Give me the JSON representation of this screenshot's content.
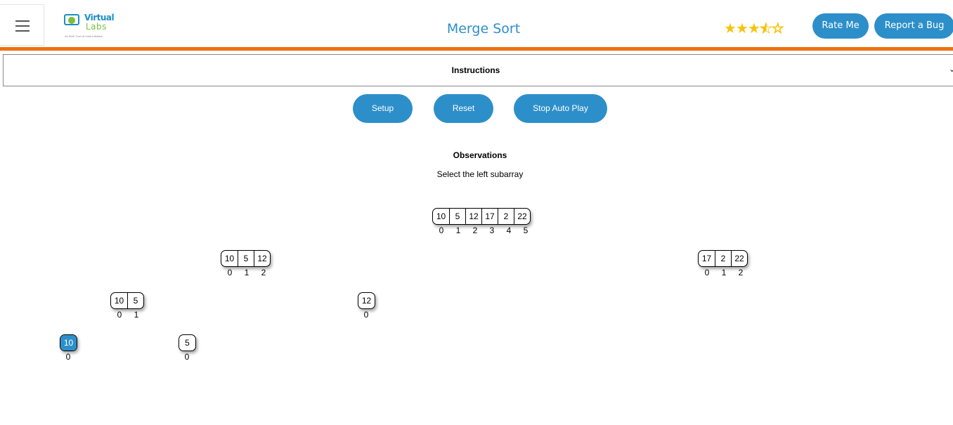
{
  "header": {
    "title": "Merge Sort",
    "logo": {
      "line1": "Virtual",
      "line2": "Labs",
      "tagline": "An MoE Govt of India Initiative"
    },
    "rating_stars": [
      "★",
      "★",
      "★",
      "★",
      "☆"
    ],
    "rating_value": 3.5,
    "rate_label": "Rate Me",
    "bug_label": "Report a Bug"
  },
  "instructions": {
    "label": "Instructions",
    "caret": "⌄"
  },
  "controls": {
    "setup": "Setup",
    "reset": "Reset",
    "stop": "Stop Auto Play"
  },
  "observations": {
    "title": "Observations",
    "text": "Select the left subarray"
  },
  "arrays": {
    "root": {
      "values": [
        "10",
        "5",
        "12",
        "17",
        "2",
        "22"
      ],
      "indices": [
        "0",
        "1",
        "2",
        "3",
        "4",
        "5"
      ]
    },
    "left": {
      "values": [
        "10",
        "5",
        "12"
      ],
      "indices": [
        "0",
        "1",
        "2"
      ]
    },
    "right": {
      "values": [
        "17",
        "2",
        "22"
      ],
      "indices": [
        "0",
        "1",
        "2"
      ]
    },
    "ll": {
      "values": [
        "10",
        "5"
      ],
      "indices": [
        "0",
        "1"
      ]
    },
    "lr": {
      "values": [
        "12"
      ],
      "indices": [
        "0"
      ]
    },
    "lll": {
      "values": [
        "10"
      ],
      "indices": [
        "0"
      ],
      "selected": true
    },
    "llr": {
      "values": [
        "5"
      ],
      "indices": [
        "0"
      ]
    }
  },
  "colors": {
    "accent": "#2d8fc9",
    "orange_bar": "#f1700f",
    "star": "#f5c40a"
  }
}
